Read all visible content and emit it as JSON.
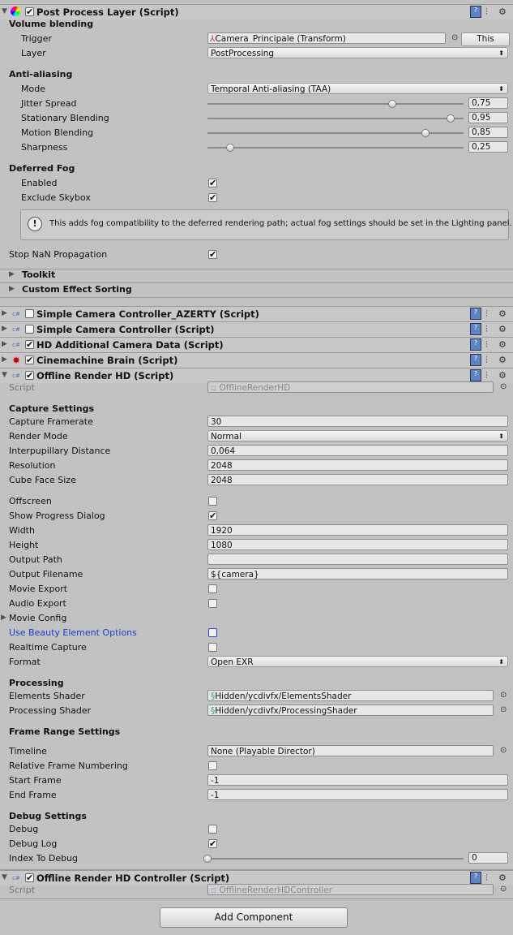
{
  "components": [
    {
      "title": "Post Process Layer (Script)",
      "enabled": true,
      "expanded": true,
      "icon": "post-process-icon"
    },
    {
      "title": "Simple Camera Controller_AZERTY (Script)",
      "enabled": false,
      "expanded": false,
      "icon": "csharp-script-icon"
    },
    {
      "title": "Simple Camera Controller (Script)",
      "enabled": false,
      "expanded": false,
      "icon": "csharp-script-icon"
    },
    {
      "title": "HD Additional Camera Data (Script)",
      "enabled": true,
      "expanded": false,
      "icon": "csharp-script-icon"
    },
    {
      "title": "Cinemachine Brain (Script)",
      "enabled": true,
      "expanded": false,
      "icon": "cinemachine-icon"
    },
    {
      "title": "Offline Render HD (Script)",
      "enabled": true,
      "expanded": true,
      "icon": "csharp-script-icon"
    },
    {
      "title": "Offline Render HD Controller (Script)",
      "enabled": true,
      "expanded": true,
      "icon": "csharp-script-icon"
    }
  ],
  "ppl": {
    "volume_blending": "Volume blending",
    "trigger_label": "Trigger",
    "trigger_value": "Camera_Principale (Transform)",
    "this_button": "This",
    "layer_label": "Layer",
    "layer_value": "PostProcessing",
    "anti_aliasing": "Anti-aliasing",
    "mode_label": "Mode",
    "mode_value": "Temporal Anti-aliasing (TAA)",
    "sliders": [
      {
        "label": "Jitter Spread",
        "value": "0,75",
        "fraction": 0.72
      },
      {
        "label": "Stationary Blending",
        "value": "0,95",
        "fraction": 0.95
      },
      {
        "label": "Motion Blending",
        "value": "0,85",
        "fraction": 0.85
      },
      {
        "label": "Sharpness",
        "value": "0,25",
        "fraction": 0.09
      }
    ],
    "deferred_fog": "Deferred Fog",
    "enabled_label": "Enabled",
    "enabled": true,
    "exclude_skybox_label": "Exclude Skybox",
    "exclude_skybox": true,
    "help_text": "This adds fog compatibility to the deferred rendering path; actual fog settings should be set in the Lighting panel.",
    "stop_nan_label": "Stop NaN Propagation",
    "stop_nan": true,
    "toolkit": "Toolkit",
    "custom_effect_sorting": "Custom Effect Sorting"
  },
  "orhd": {
    "script_label": "Script",
    "script_value": "OfflineRenderHD",
    "rows": [
      {
        "kind": "section",
        "label": "Capture Settings"
      },
      {
        "kind": "text",
        "label": "Capture Framerate",
        "value": "30"
      },
      {
        "kind": "dropdown",
        "label": "Render Mode",
        "value": "Normal"
      },
      {
        "kind": "text",
        "label": "Interpupillary Distance",
        "value": "0,064"
      },
      {
        "kind": "text",
        "label": "Resolution",
        "value": "2048"
      },
      {
        "kind": "text",
        "label": "Cube Face Size",
        "value": "2048"
      },
      {
        "kind": "check",
        "label": "Offscreen",
        "checked": false
      },
      {
        "kind": "check",
        "label": "Show Progress Dialog",
        "checked": true
      },
      {
        "kind": "text",
        "label": "Width",
        "value": "1920"
      },
      {
        "kind": "text",
        "label": "Height",
        "value": "1080"
      },
      {
        "kind": "text",
        "label": "Output Path",
        "value": ""
      },
      {
        "kind": "text",
        "label": "Output Filename",
        "value": "${camera}"
      },
      {
        "kind": "check",
        "label": "Movie Export",
        "checked": false
      },
      {
        "kind": "check",
        "label": "Audio Export",
        "checked": false
      },
      {
        "kind": "foldout",
        "label": "Movie Config"
      },
      {
        "kind": "check",
        "label": "Use Beauty Element Options",
        "checked": false,
        "highlight": true
      },
      {
        "kind": "check",
        "label": "Realtime Capture",
        "checked": false
      },
      {
        "kind": "dropdown",
        "label": "Format",
        "value": "Open EXR"
      },
      {
        "kind": "section",
        "label": "Processing"
      },
      {
        "kind": "object",
        "label": "Elements Shader",
        "value": "Hidden/ycdivfx/ElementsShader"
      },
      {
        "kind": "object",
        "label": "Processing Shader",
        "value": "Hidden/ycdivfx/ProcessingShader"
      },
      {
        "kind": "section",
        "label": "Frame Range Settings"
      },
      {
        "kind": "object",
        "label": "Timeline",
        "value": "None (Playable Director)"
      },
      {
        "kind": "check",
        "label": "Relative Frame Numbering",
        "checked": false
      },
      {
        "kind": "text",
        "label": "Start Frame",
        "value": "-1"
      },
      {
        "kind": "text",
        "label": "End Frame",
        "value": "-1"
      },
      {
        "kind": "section",
        "label": "Debug Settings"
      },
      {
        "kind": "check",
        "label": "Debug",
        "checked": false
      },
      {
        "kind": "check",
        "label": "Debug Log",
        "checked": true
      },
      {
        "kind": "slider",
        "label": "Index To Debug",
        "value": "0",
        "fraction": 0
      }
    ]
  },
  "controller": {
    "script_label": "Script",
    "script_value": "OfflineRenderHDController"
  },
  "add_component": "Add Component",
  "colors": {
    "background": "#c2c2c2",
    "highlight_label": "#1a3ccf"
  }
}
